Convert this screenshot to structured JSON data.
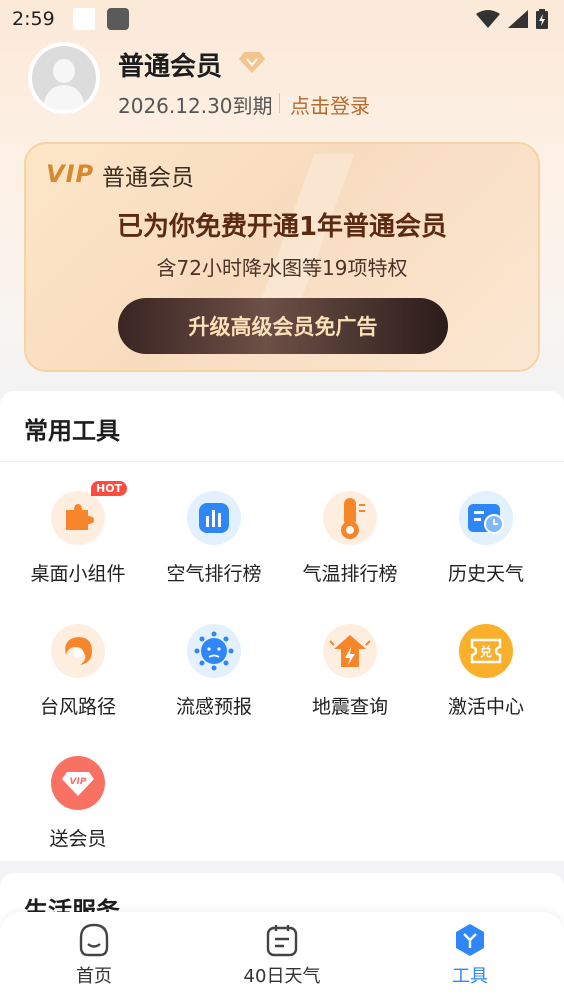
{
  "status": {
    "time": "2:59"
  },
  "profile": {
    "name": "普通会员",
    "expire": "2026.12.30到期",
    "login": "点击登录"
  },
  "vip": {
    "logo": "VIP",
    "tier": "普通会员",
    "headline": "已为你免费开通1年普通会员",
    "sub": "含72小时降水图等19项特权",
    "button": "升级高级会员免广告"
  },
  "tools": {
    "title": "常用工具",
    "items": [
      {
        "label": "桌面小组件",
        "icon": "puzzle-icon",
        "badge": "HOT"
      },
      {
        "label": "空气排行榜",
        "icon": "bar-chart-icon"
      },
      {
        "label": "气温排行榜",
        "icon": "thermometer-icon"
      },
      {
        "label": "历史天气",
        "icon": "history-calendar-icon"
      },
      {
        "label": "台风路径",
        "icon": "typhoon-icon"
      },
      {
        "label": "流感预报",
        "icon": "virus-icon"
      },
      {
        "label": "地震查询",
        "icon": "earthquake-icon"
      },
      {
        "label": "激活中心",
        "icon": "redeem-icon",
        "icon_text": "兑"
      },
      {
        "label": "送会员",
        "icon": "vip-gift-icon",
        "icon_text": "VIP"
      }
    ]
  },
  "life": {
    "title": "生活服务"
  },
  "nav": {
    "items": [
      {
        "label": "首页",
        "icon": "home-icon"
      },
      {
        "label": "40日天气",
        "icon": "calendar-icon"
      },
      {
        "label": "工具",
        "icon": "tools-icon"
      }
    ],
    "active_color": "#2f86f6"
  }
}
